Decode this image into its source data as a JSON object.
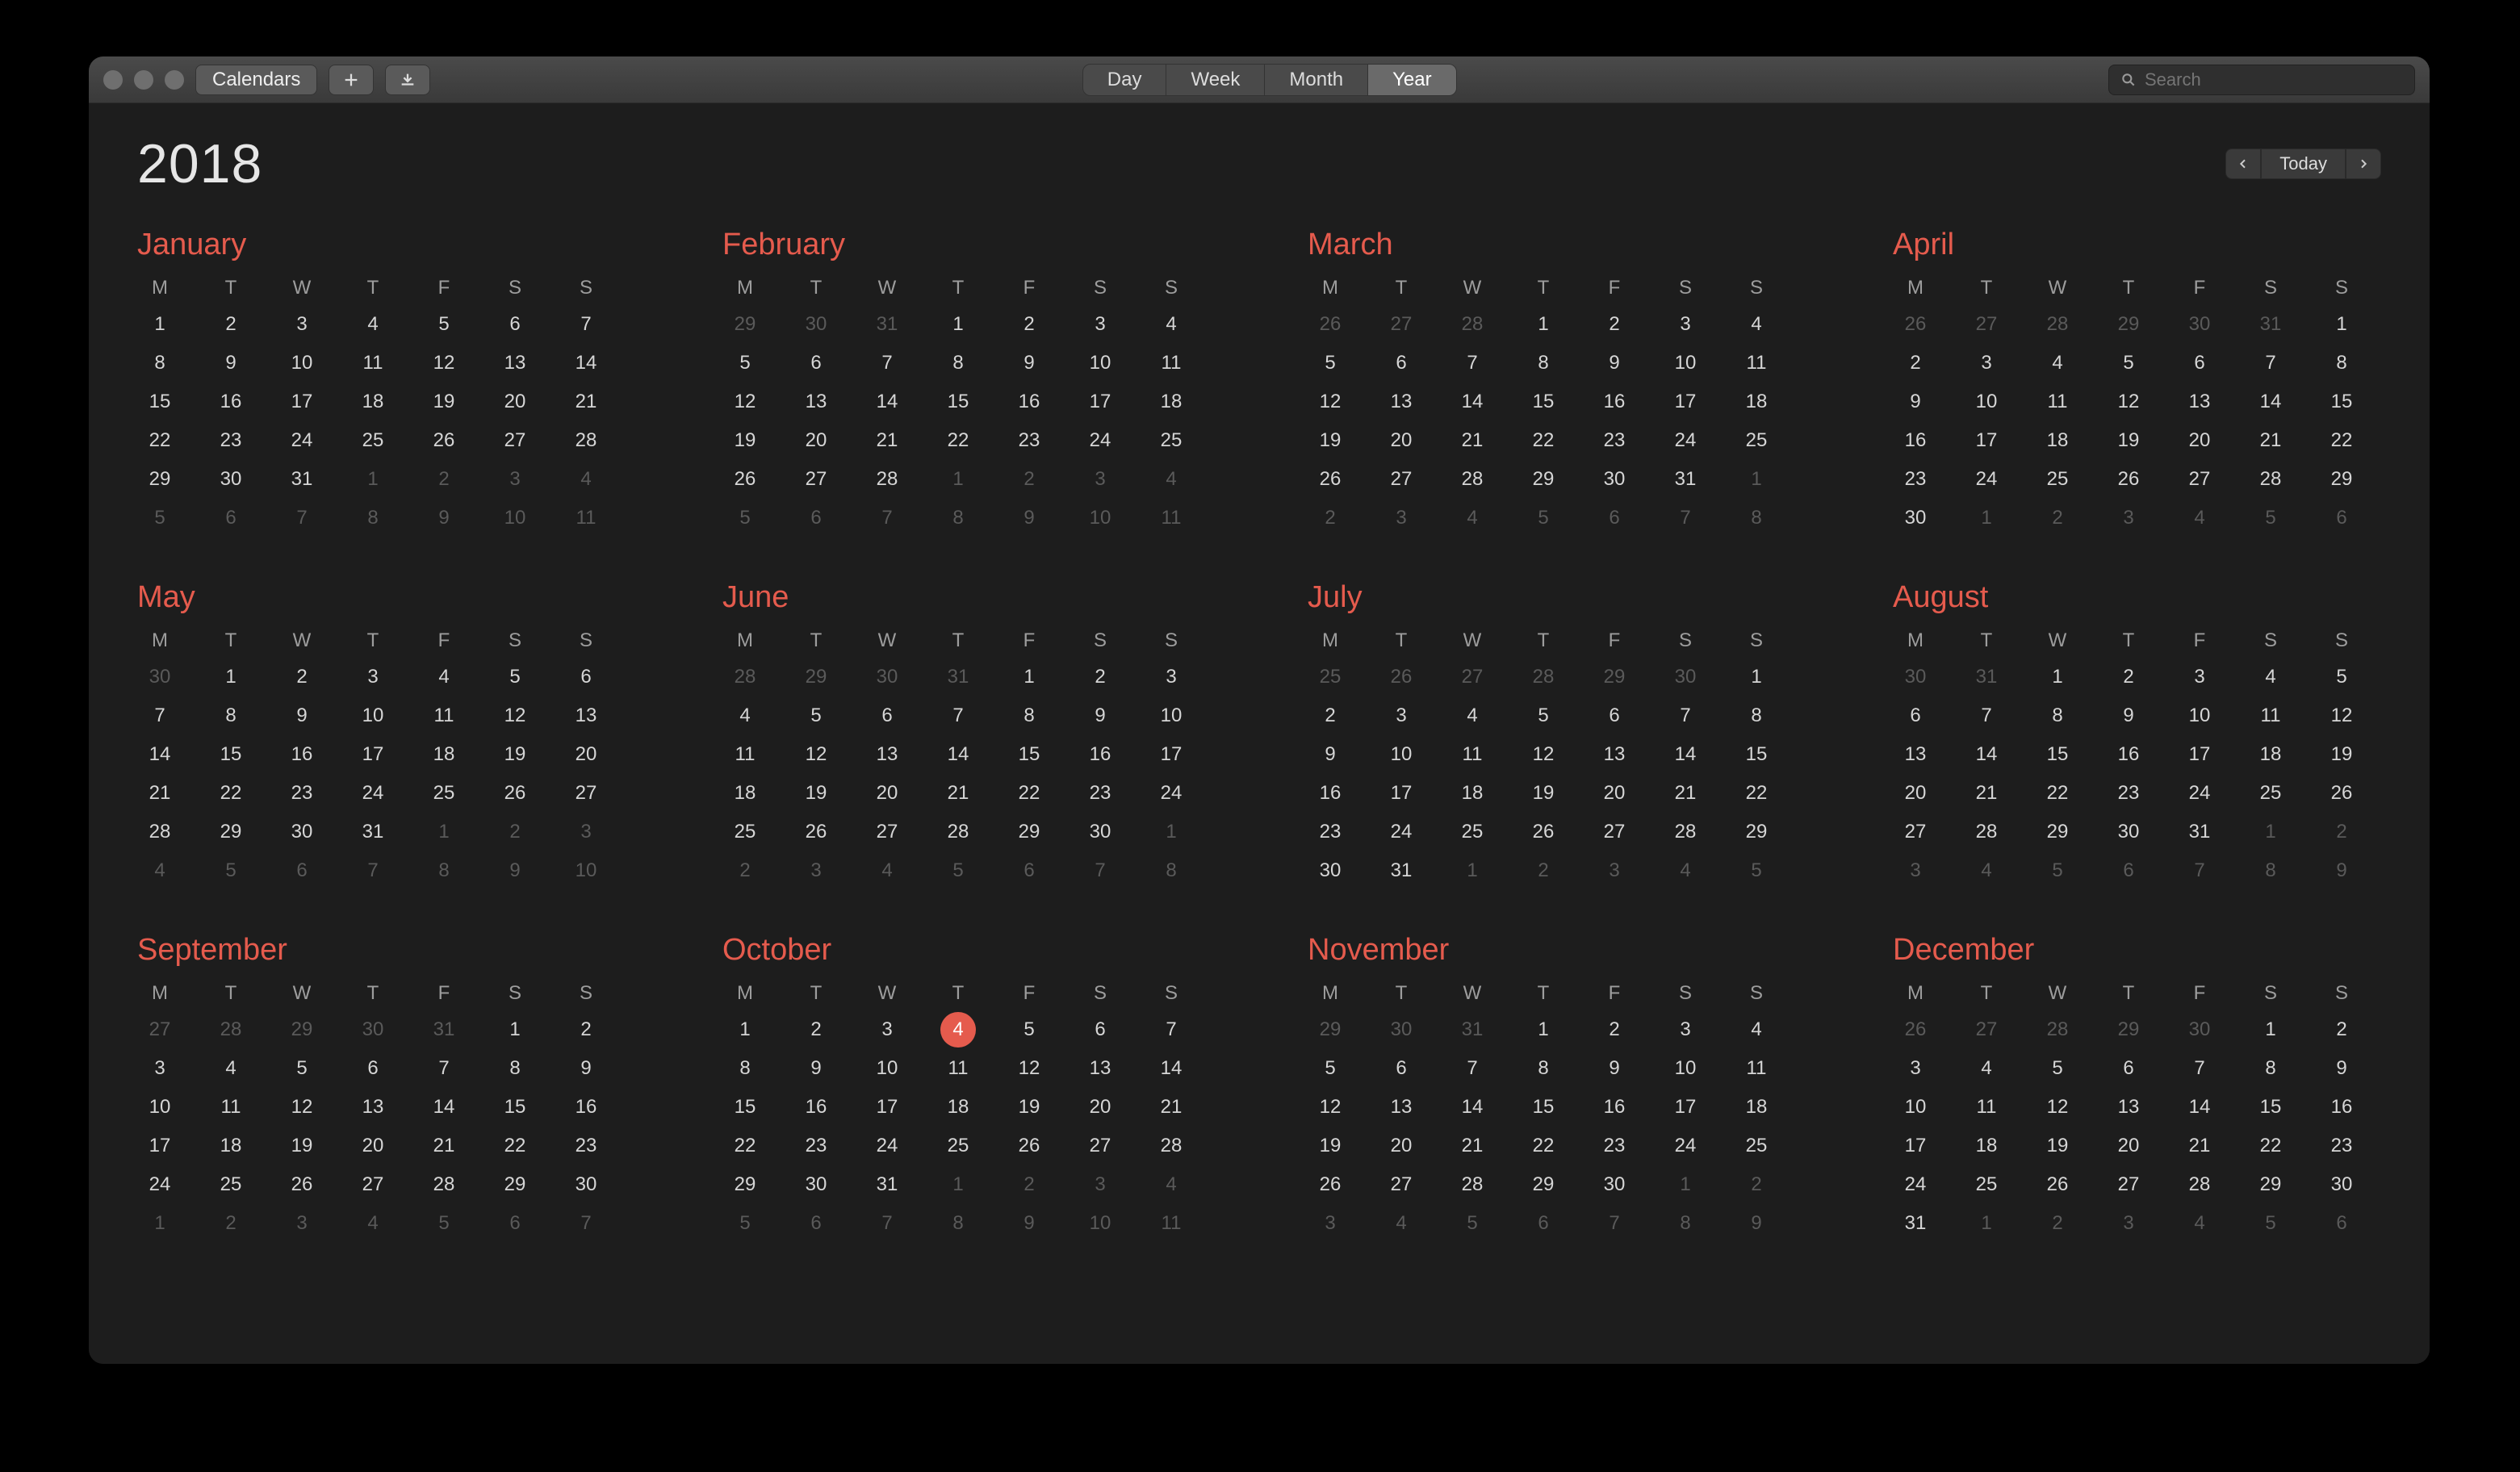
{
  "toolbar": {
    "calendars_label": "Calendars",
    "view_modes": [
      "Day",
      "Week",
      "Month",
      "Year"
    ],
    "active_view": "Year",
    "search_placeholder": "Search",
    "today_label": "Today"
  },
  "year": "2018",
  "today": {
    "month": "October",
    "day": 4
  },
  "dow": [
    "M",
    "T",
    "W",
    "T",
    "F",
    "S",
    "S"
  ],
  "months": [
    {
      "name": "January",
      "lead": 0,
      "days": 31,
      "prev_tail": 31,
      "next_head": 11
    },
    {
      "name": "February",
      "lead": 3,
      "days": 28,
      "prev_tail": 31,
      "next_head": 11
    },
    {
      "name": "March",
      "lead": 3,
      "days": 31,
      "prev_tail": 28,
      "next_head": 8
    },
    {
      "name": "April",
      "lead": 6,
      "days": 30,
      "prev_tail": 31,
      "next_head": 6
    },
    {
      "name": "May",
      "lead": 1,
      "days": 31,
      "prev_tail": 30,
      "next_head": 10
    },
    {
      "name": "June",
      "lead": 4,
      "days": 30,
      "prev_tail": 31,
      "next_head": 8
    },
    {
      "name": "July",
      "lead": 6,
      "days": 31,
      "prev_tail": 30,
      "next_head": 5
    },
    {
      "name": "August",
      "lead": 2,
      "days": 31,
      "prev_tail": 31,
      "next_head": 9
    },
    {
      "name": "September",
      "lead": 5,
      "days": 30,
      "prev_tail": 31,
      "next_head": 7
    },
    {
      "name": "October",
      "lead": 0,
      "days": 31,
      "prev_tail": 30,
      "next_head": 11
    },
    {
      "name": "November",
      "lead": 3,
      "days": 30,
      "prev_tail": 31,
      "next_head": 9
    },
    {
      "name": "December",
      "lead": 5,
      "days": 31,
      "prev_tail": 30,
      "next_head": 6
    }
  ]
}
